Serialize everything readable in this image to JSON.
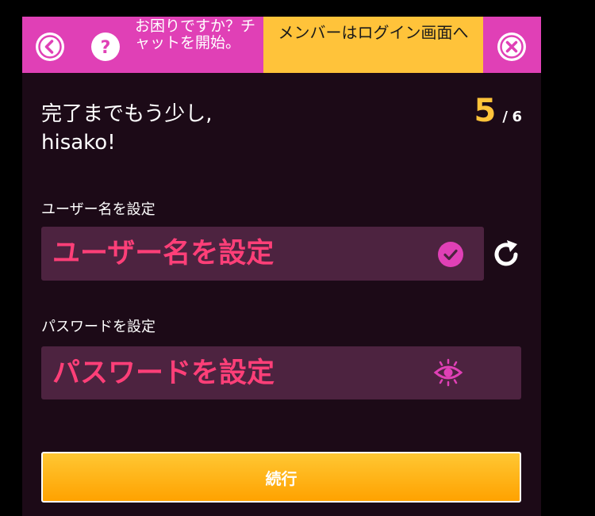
{
  "header": {
    "help_text": "お困りですか？チャットを開始。",
    "login_link": "メンバーはログイン画面へ"
  },
  "greeting": {
    "line1": "完了までもう少し,",
    "line2": "hisako!"
  },
  "progress": {
    "current": "5",
    "separator": "/",
    "total": "6"
  },
  "username": {
    "label": "ユーザー名を設定",
    "value": "ユーザー名を設定"
  },
  "password": {
    "label": "パスワードを設定",
    "value": "パスワードを設定"
  },
  "continue_label": "続行",
  "icons": {
    "back": "chevron-left-circle-icon",
    "help": "question-circle-icon",
    "close": "close-circle-icon",
    "valid": "check-circle-icon",
    "refresh": "refresh-icon",
    "eye": "eye-icon"
  },
  "colors": {
    "magenta": "#e040b6",
    "yellow": "#ffc33a",
    "panel_bg": "#1c0a17",
    "field_bg": "#4d2340",
    "field_text": "#ff3f78",
    "button_orange": "#ffa200"
  }
}
